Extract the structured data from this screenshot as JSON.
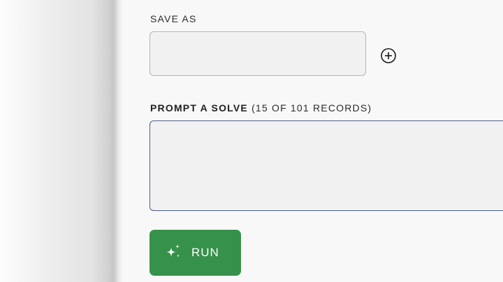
{
  "save_as": {
    "label": "SAVE AS",
    "value": "",
    "add_icon": "plus-circle-icon"
  },
  "prompt": {
    "label_bold": "PROMPT A SOLVE",
    "label_detail": "(15 OF 101 RECORDS)",
    "value": ""
  },
  "run": {
    "label": "RUN",
    "icon": "sparkle-icon",
    "color": "#36914a"
  },
  "colors": {
    "accent_border": "#4a5d8a",
    "button_green": "#36914a"
  }
}
